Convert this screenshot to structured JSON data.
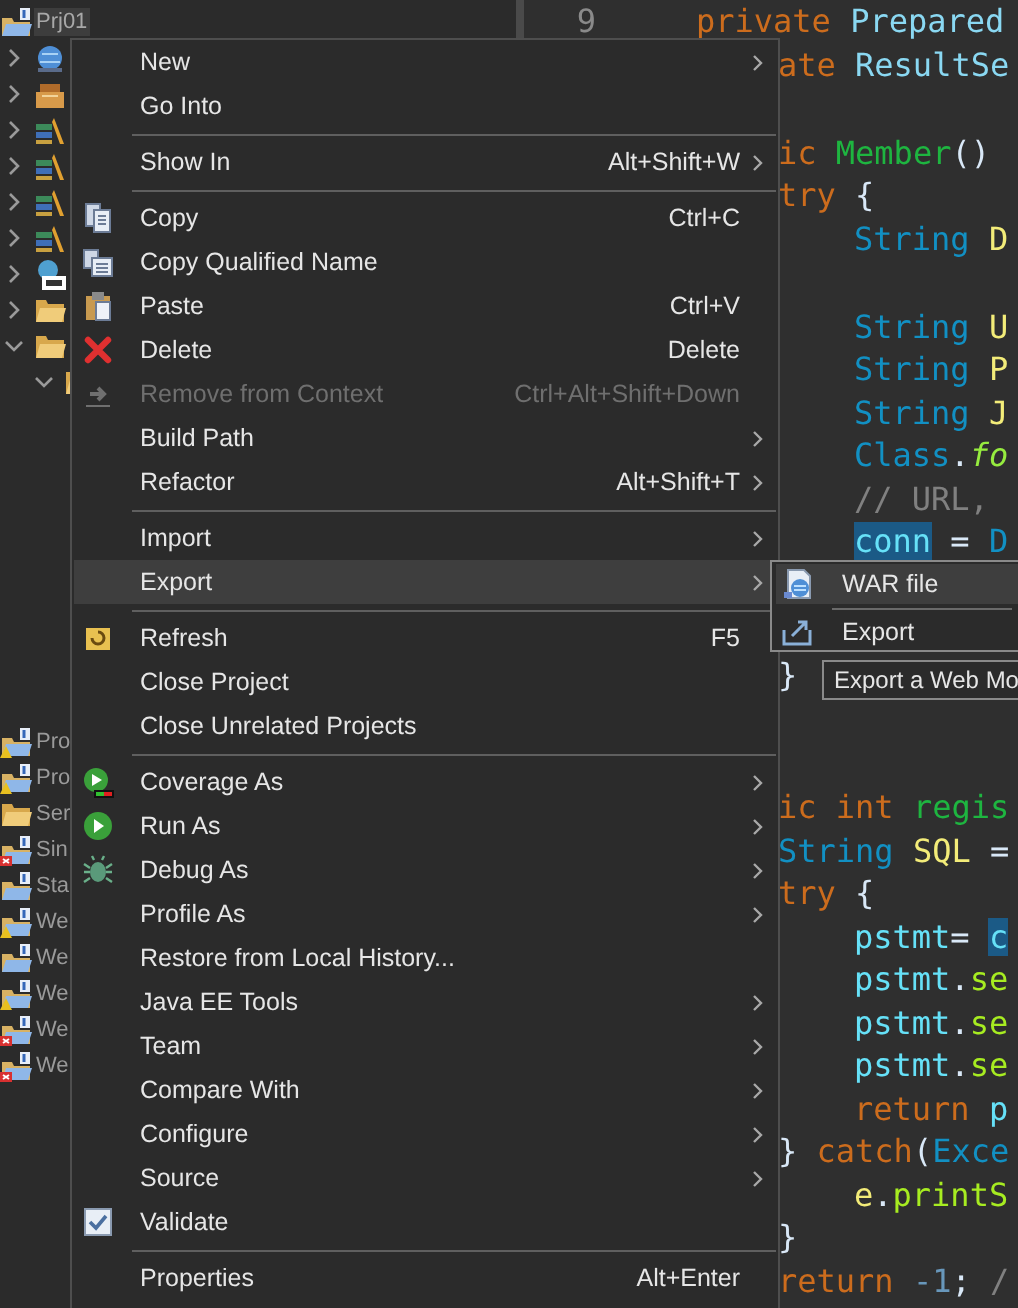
{
  "explorer": {
    "tree": [
      {
        "label": "Prj01",
        "kind": "project",
        "selected": true,
        "children": [
          {
            "kind": "globe",
            "expanded": false
          },
          {
            "kind": "jar",
            "expanded": false
          },
          {
            "kind": "library",
            "expanded": false
          },
          {
            "kind": "library",
            "expanded": false
          },
          {
            "kind": "library",
            "expanded": false
          },
          {
            "kind": "library",
            "expanded": false
          },
          {
            "kind": "runtime",
            "expanded": false
          },
          {
            "kind": "folder",
            "expanded": false
          },
          {
            "kind": "folder",
            "expanded": true,
            "children": [
              {
                "kind": "folder",
                "expanded": true
              }
            ]
          }
        ]
      }
    ],
    "lower_items": [
      {
        "label": "Pro",
        "kind": "project_warning"
      },
      {
        "label": "Pro",
        "kind": "project_warning"
      },
      {
        "label": "Ser",
        "kind": "folder"
      },
      {
        "label": "Sin",
        "kind": "project_error"
      },
      {
        "label": "Sta",
        "kind": "project"
      },
      {
        "label": "We",
        "kind": "project_warning"
      },
      {
        "label": "We",
        "kind": "project"
      },
      {
        "label": "We",
        "kind": "project_warning"
      },
      {
        "label": "We",
        "kind": "project_error"
      },
      {
        "label": "We",
        "kind": "project_error"
      }
    ]
  },
  "editor": {
    "lines": [
      {
        "kind": "top",
        "number": "9",
        "tokens": [
          {
            "text": "private ",
            "kind": "keyword"
          },
          {
            "text": "Prepared",
            "kind": "class"
          }
        ]
      },
      {
        "kind": "outer",
        "tokens": [
          {
            "text": "ate ",
            "kind": "keyword"
          },
          {
            "text": "ResultSe",
            "kind": "class"
          }
        ]
      },
      {
        "kind": "blank"
      },
      {
        "kind": "outer",
        "tokens": [
          {
            "text": "ic ",
            "kind": "keyword"
          },
          {
            "text": "Member",
            "kind": "method"
          },
          {
            "text": "()",
            "kind": "plain"
          }
        ]
      },
      {
        "kind": "outer",
        "tokens": [
          {
            "text": "try",
            "kind": "keyword"
          },
          {
            "text": " {",
            "kind": "plain"
          }
        ]
      },
      {
        "kind": "inner",
        "tokens": [
          {
            "text": "String ",
            "kind": "type"
          },
          {
            "text": "D",
            "kind": "local"
          }
        ]
      },
      {
        "kind": "blank"
      },
      {
        "kind": "inner",
        "tokens": [
          {
            "text": "String ",
            "kind": "type"
          },
          {
            "text": "U",
            "kind": "local"
          }
        ]
      },
      {
        "kind": "inner",
        "tokens": [
          {
            "text": "String ",
            "kind": "type"
          },
          {
            "text": "P",
            "kind": "local"
          }
        ]
      },
      {
        "kind": "inner",
        "tokens": [
          {
            "text": "String ",
            "kind": "type"
          },
          {
            "text": "J",
            "kind": "local"
          }
        ]
      },
      {
        "kind": "inner",
        "tokens": [
          {
            "text": "Class",
            "kind": "type"
          },
          {
            "text": ".",
            "kind": "plain"
          },
          {
            "text": "fo",
            "kind": "static"
          }
        ]
      },
      {
        "kind": "inner",
        "tokens": [
          {
            "text": "// URL,",
            "kind": "comment"
          }
        ]
      },
      {
        "kind": "inner",
        "tokens": [
          {
            "text": "conn",
            "kind": "field",
            "highlighted": true
          },
          {
            "text": " = ",
            "kind": "plain"
          },
          {
            "text": "D",
            "kind": "type"
          }
        ]
      },
      {
        "kind": "blank"
      },
      {
        "kind": "blank"
      },
      {
        "kind": "outer",
        "tokens": [
          {
            "text": "}",
            "kind": "plain"
          }
        ]
      },
      {
        "kind": "blank"
      },
      {
        "kind": "blank"
      },
      {
        "kind": "outer",
        "tokens": [
          {
            "text": "ic int ",
            "kind": "keyword"
          },
          {
            "text": "regis",
            "kind": "method"
          }
        ]
      },
      {
        "kind": "outer",
        "tokens": [
          {
            "text": "String ",
            "kind": "type"
          },
          {
            "text": "SQL",
            "kind": "local"
          },
          {
            "text": " =",
            "kind": "plain"
          }
        ]
      },
      {
        "kind": "outer",
        "tokens": [
          {
            "text": "try",
            "kind": "keyword"
          },
          {
            "text": " {",
            "kind": "plain"
          }
        ]
      },
      {
        "kind": "inner",
        "tokens": [
          {
            "text": "pstmt",
            "kind": "field"
          },
          {
            "text": "= ",
            "kind": "plain"
          },
          {
            "text": "c",
            "kind": "field",
            "highlighted": true
          }
        ]
      },
      {
        "kind": "inner",
        "tokens": [
          {
            "text": "pstmt",
            "kind": "field"
          },
          {
            "text": ".",
            "kind": "plain"
          },
          {
            "text": "se",
            "kind": "call"
          }
        ]
      },
      {
        "kind": "inner",
        "tokens": [
          {
            "text": "pstmt",
            "kind": "field"
          },
          {
            "text": ".",
            "kind": "plain"
          },
          {
            "text": "se",
            "kind": "call"
          }
        ]
      },
      {
        "kind": "inner",
        "tokens": [
          {
            "text": "pstmt",
            "kind": "field"
          },
          {
            "text": ".",
            "kind": "plain"
          },
          {
            "text": "se",
            "kind": "call"
          }
        ]
      },
      {
        "kind": "inner",
        "tokens": [
          {
            "text": "return ",
            "kind": "keyword"
          },
          {
            "text": "p",
            "kind": "field"
          }
        ]
      },
      {
        "kind": "outer",
        "tokens": [
          {
            "text": "} ",
            "kind": "plain"
          },
          {
            "text": "catch",
            "kind": "keyword"
          },
          {
            "text": "(",
            "kind": "plain"
          },
          {
            "text": "Exce",
            "kind": "type"
          }
        ]
      },
      {
        "kind": "inner",
        "tokens": [
          {
            "text": "e",
            "kind": "local"
          },
          {
            "text": ".",
            "kind": "plain"
          },
          {
            "text": "printS",
            "kind": "call"
          }
        ]
      },
      {
        "kind": "outer",
        "tokens": [
          {
            "text": "}",
            "kind": "plain"
          }
        ]
      },
      {
        "kind": "outer",
        "tokens": [
          {
            "text": "return ",
            "kind": "keyword"
          },
          {
            "text": "-1",
            "kind": "number"
          },
          {
            "text": "; ",
            "kind": "plain"
          },
          {
            "text": "/",
            "kind": "comment"
          }
        ]
      }
    ]
  },
  "context_menu": {
    "items": [
      {
        "kind": "plain",
        "label": "New",
        "submenu": true
      },
      {
        "kind": "plain",
        "label": "Go Into"
      },
      {
        "kind": "separator"
      },
      {
        "kind": "plain",
        "label": "Show In",
        "shortcut": "Alt+Shift+W",
        "submenu": true
      },
      {
        "kind": "separator"
      },
      {
        "kind": "copy",
        "label": "Copy",
        "shortcut": "Ctrl+C"
      },
      {
        "kind": "copy_name",
        "label": "Copy Qualified Name"
      },
      {
        "kind": "paste",
        "label": "Paste",
        "shortcut": "Ctrl+V"
      },
      {
        "kind": "delete",
        "label": "Delete",
        "shortcut": "Delete"
      },
      {
        "kind": "remove",
        "label": "Remove from Context",
        "shortcut": "Ctrl+Alt+Shift+Down",
        "disabled": true
      },
      {
        "kind": "plain",
        "label": "Build Path",
        "submenu": true
      },
      {
        "kind": "plain",
        "label": "Refactor",
        "shortcut": "Alt+Shift+T",
        "submenu": true
      },
      {
        "kind": "separator"
      },
      {
        "kind": "plain",
        "label": "Import",
        "submenu": true
      },
      {
        "kind": "plain",
        "label": "Export",
        "submenu": true,
        "selected": true
      },
      {
        "kind": "separator"
      },
      {
        "kind": "refresh",
        "label": "Refresh",
        "shortcut": "F5"
      },
      {
        "kind": "plain",
        "label": "Close Project"
      },
      {
        "kind": "plain",
        "label": "Close Unrelated Projects"
      },
      {
        "kind": "separator"
      },
      {
        "kind": "coverage",
        "label": "Coverage As",
        "submenu": true
      },
      {
        "kind": "run",
        "label": "Run As",
        "submenu": true
      },
      {
        "kind": "debug",
        "label": "Debug As",
        "submenu": true
      },
      {
        "kind": "plain",
        "label": "Profile As",
        "submenu": true
      },
      {
        "kind": "plain",
        "label": "Restore from Local History..."
      },
      {
        "kind": "plain",
        "label": "Java EE Tools",
        "submenu": true
      },
      {
        "kind": "plain",
        "label": "Team",
        "submenu": true
      },
      {
        "kind": "plain",
        "label": "Compare With",
        "submenu": true
      },
      {
        "kind": "plain",
        "label": "Configure",
        "submenu": true
      },
      {
        "kind": "plain",
        "label": "Source",
        "submenu": true
      },
      {
        "kind": "validate",
        "label": "Validate"
      },
      {
        "kind": "separator"
      },
      {
        "kind": "plain",
        "label": "Properties",
        "shortcut": "Alt+Enter"
      }
    ]
  },
  "export_submenu": {
    "items": [
      {
        "kind": "war",
        "label": "WAR file",
        "selected": true
      },
      {
        "kind": "separator"
      },
      {
        "kind": "export",
        "label": "Export"
      }
    ]
  },
  "tooltip": {
    "text": "Export a Web Mo"
  }
}
